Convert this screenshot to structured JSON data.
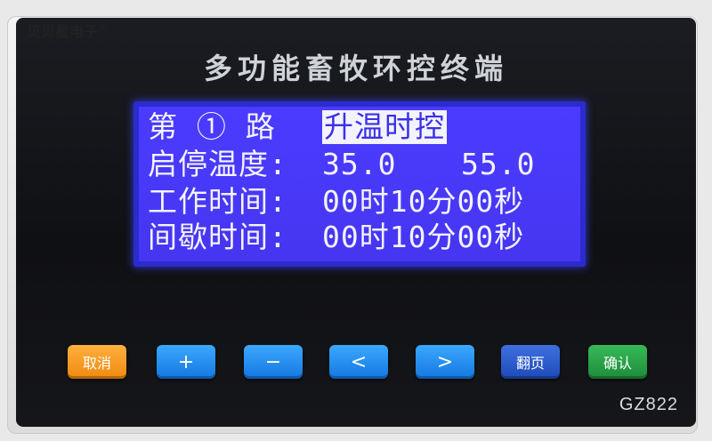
{
  "brand": {
    "name": "贝贝星电子",
    "mark": "®"
  },
  "device": {
    "title": "多功能畜牧环控终端",
    "model": "GZ822"
  },
  "lcd": {
    "row1": {
      "label": "第 ① 路",
      "mode": "升温时控"
    },
    "row2": {
      "label": "启停温度:",
      "start": "35.0",
      "stop": "55.0"
    },
    "row3": {
      "label": "工作时间:",
      "value": "00时10分00秒"
    },
    "row4": {
      "label": "间歇时间:",
      "value": "00时10分00秒"
    }
  },
  "keys": {
    "cancel": "取消",
    "plus": "+",
    "minus": "−",
    "left": "<",
    "right": ">",
    "page": "翻页",
    "confirm": "确认"
  },
  "colors": {
    "lcd_bg": "#4b3bff",
    "lcd_text": "#f3f3ff",
    "panel": "#15161a"
  }
}
